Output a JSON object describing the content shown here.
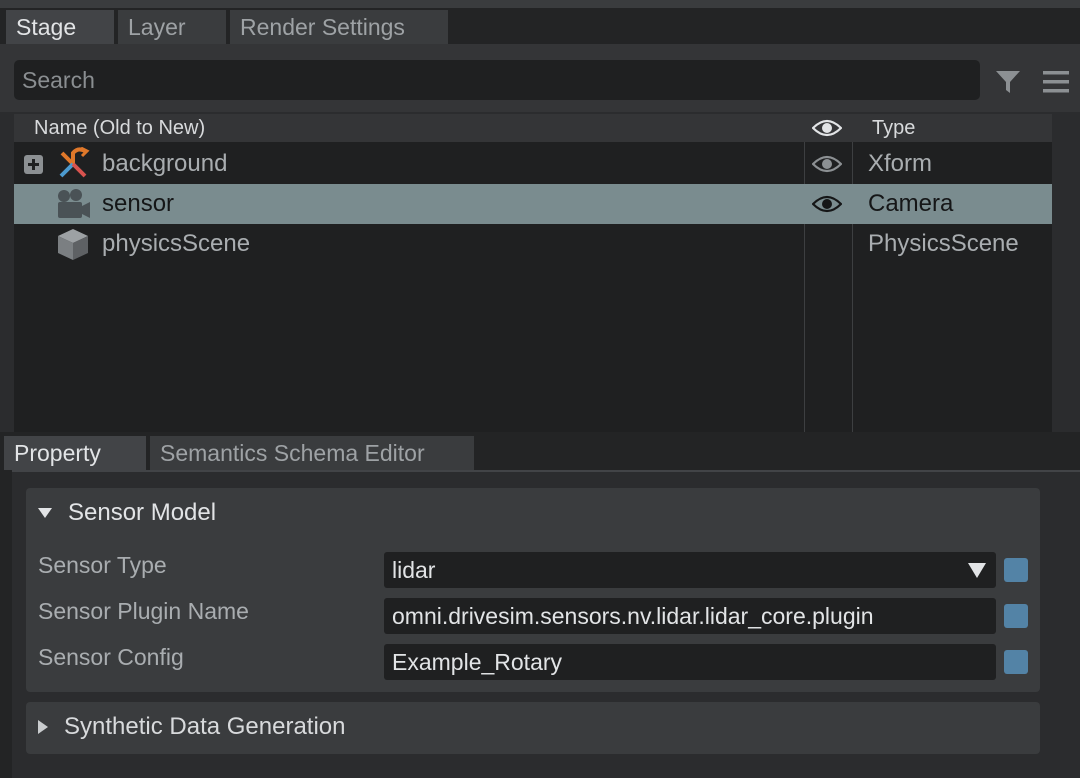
{
  "stage_tabs": [
    "Stage",
    "Layer",
    "Render Settings"
  ],
  "search": {
    "placeholder": "Search"
  },
  "tree": {
    "columns": {
      "name": "Name (Old to New)",
      "type": "Type"
    },
    "rows": [
      {
        "name": "background",
        "type": "Xform",
        "icon": "xform-icon",
        "expandable": true,
        "visible": true,
        "selected": false
      },
      {
        "name": "sensor",
        "type": "Camera",
        "icon": "camera-icon",
        "expandable": false,
        "visible": true,
        "selected": true
      },
      {
        "name": "physicsScene",
        "type": "PhysicsScene",
        "icon": "cube-icon",
        "expandable": false,
        "visible": false,
        "selected": false
      }
    ]
  },
  "property_tabs": [
    "Property",
    "Semantics Schema Editor"
  ],
  "sensor_model": {
    "title": "Sensor Model",
    "fields": [
      {
        "label": "Sensor Type",
        "value": "lidar",
        "kind": "dropdown"
      },
      {
        "label": "Sensor Plugin Name",
        "value": "omni.drivesim.sensors.nv.lidar.lidar_core.plugin",
        "kind": "text"
      },
      {
        "label": "Sensor Config",
        "value": "Example_Rotary",
        "kind": "text"
      }
    ]
  },
  "synthetic_data": {
    "title": "Synthetic Data Generation"
  },
  "colors": {
    "selection": "#7a8c8f",
    "reset_box": "#5383a6",
    "panel_bg": "#2b2c2e",
    "field_bg": "#1f2021"
  }
}
